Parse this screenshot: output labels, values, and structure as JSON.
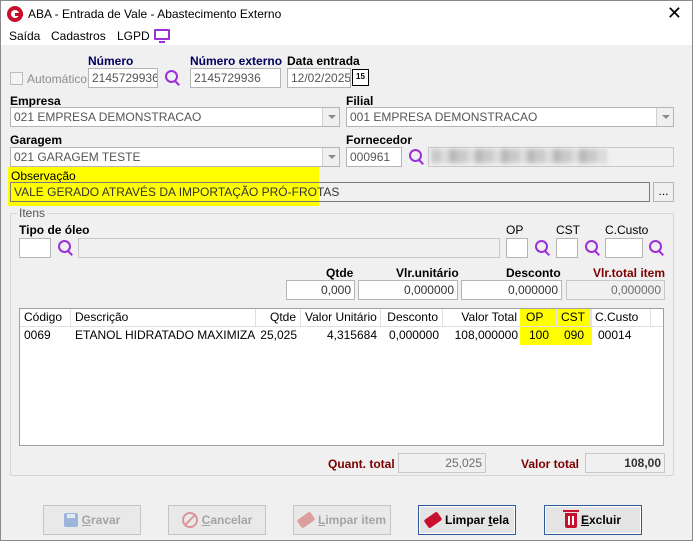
{
  "window": {
    "title": "ABA - Entrada de Vale - Abastecimento Externo",
    "close": "✕"
  },
  "menu": [
    "Saída",
    "Cadastros",
    "LGPD"
  ],
  "header": {
    "automatico_label": "Automático",
    "numero_label": "Número",
    "numero_value": "2145729936",
    "numero_externo_label": "Número externo",
    "numero_externo_value": "2145729936",
    "data_entrada_label": "Data entrada",
    "data_entrada_value": "12/02/2025",
    "calendar_glyph": "15"
  },
  "empresa": {
    "label": "Empresa",
    "value": "021 EMPRESA DEMONSTRACAO"
  },
  "filial": {
    "label": "Filial",
    "value": "001 EMPRESA DEMONSTRACAO"
  },
  "garagem": {
    "label": "Garagem",
    "value": "021 GARAGEM TESTE"
  },
  "fornecedor": {
    "label": "Fornecedor",
    "code": "000961"
  },
  "observacao": {
    "label": "Observação",
    "value": "VALE GERADO ATRAVÉS DA IMPORTAÇÃO PRÓ-FROTAS",
    "ellipsis": "..."
  },
  "itens": {
    "group_label": "Itens",
    "tipo_oleo_label": "Tipo de óleo",
    "op_label": "OP",
    "cst_label": "CST",
    "ccusto_label": "C.Custo",
    "qtde_label": "Qtde",
    "vlr_unitario_label": "Vlr.unitário",
    "desconto_label": "Desconto",
    "vlr_total_item_label": "Vlr.total item",
    "qtde_value": "0,000",
    "vlr_unitario_value": "0,000000",
    "desconto_value": "0,000000",
    "vlr_total_item_value": "0,000000"
  },
  "grid": {
    "columns": [
      "Código",
      "Descrição",
      "Qtde",
      "Valor Unitário",
      "Desconto",
      "Valor Total",
      "OP",
      "CST",
      "C.Custo"
    ],
    "rows": [
      [
        "0069",
        "ETANOL HIDRATADO MAXIMIZA...",
        "25,025",
        "4,315684",
        "0,000000",
        "108,000000",
        "100",
        "090",
        "00014"
      ]
    ]
  },
  "totals": {
    "quant_total_label": "Quant. total",
    "quant_total_value": "25,025",
    "valor_total_label": "Valor total",
    "valor_total_value": "108,00"
  },
  "buttons": {
    "gravar": {
      "first": "G",
      "rest": "ravar"
    },
    "cancelar": {
      "first": "C",
      "rest": "ancelar"
    },
    "limpar_item": {
      "first": "L",
      "rest": "impar item"
    },
    "limpar_tela": {
      "pre": "Limpar ",
      "first": "t",
      "rest": "ela"
    },
    "excluir": {
      "first": "E",
      "rest": "xcluir"
    }
  },
  "colors": {
    "highlight": "#ffff00",
    "accent": "#9b30d9",
    "brand": "#c8102e",
    "navy": "#00005e",
    "maroon": "#7b0000"
  },
  "icons": [
    "app-logo-icon",
    "monitor-icon",
    "search-icon",
    "calendar-icon",
    "save-icon",
    "cancel-icon",
    "eraser-icon",
    "trash-icon"
  ]
}
